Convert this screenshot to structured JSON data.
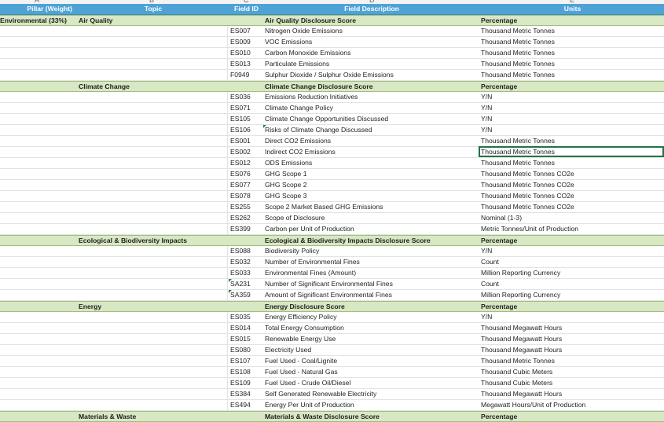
{
  "column_letters": [
    "A",
    "B",
    "C",
    "D",
    "E"
  ],
  "header": {
    "pillar": "Pillar (Weight)",
    "topic": "Topic",
    "field_id": "Field ID",
    "field_description": "Field Description",
    "units": "Units"
  },
  "rows": [
    {
      "type": "topic",
      "pillar": "Environmental (33%)",
      "topic": "Air Quality",
      "id": "",
      "desc": "Air Quality Disclosure Score",
      "unit": "Percentage"
    },
    {
      "type": "data",
      "id": "ES007",
      "desc": "Nitrogen Oxide Emissions",
      "unit": "Thousand Metric Tonnes"
    },
    {
      "type": "data",
      "id": "ES009",
      "desc": "VOC Emissions",
      "unit": "Thousand Metric Tonnes"
    },
    {
      "type": "data",
      "id": "ES010",
      "desc": "Carbon Monoxide Emissions",
      "unit": "Thousand Metric Tonnes"
    },
    {
      "type": "data",
      "id": "ES013",
      "desc": "Particulate Emissions",
      "unit": "Thousand Metric Tonnes"
    },
    {
      "type": "data",
      "id": "F0949",
      "desc": "Sulphur Dioxide / Sulphur Oxide Emissions",
      "unit": "Thousand Metric Tonnes"
    },
    {
      "type": "topic",
      "pillar": "",
      "topic": "Climate Change",
      "id": "",
      "desc": "Climate Change Disclosure Score",
      "unit": "Percentage"
    },
    {
      "type": "data",
      "id": "ES036",
      "desc": "Emissions Reduction Initiatives",
      "unit": "Y/N"
    },
    {
      "type": "data",
      "id": "ES071",
      "desc": "Climate Change Policy",
      "unit": "Y/N"
    },
    {
      "type": "data",
      "id": "ES105",
      "desc": "Climate Change Opportunities Discussed",
      "unit": "Y/N"
    },
    {
      "type": "data",
      "id": "ES106",
      "desc": "Risks of Climate Change Discussed",
      "unit": "Y/N",
      "mark": "d"
    },
    {
      "type": "data",
      "id": "ES001",
      "desc": "Direct CO2 Emissions",
      "unit": "Thousand Metric Tonnes"
    },
    {
      "type": "data",
      "id": "ES002",
      "desc": "Indirect CO2 Emissions",
      "unit": "Thousand Metric Tonnes"
    },
    {
      "type": "data",
      "id": "ES012",
      "desc": "ODS Emissions",
      "unit": "Thousand Metric Tonnes"
    },
    {
      "type": "data",
      "id": "ES076",
      "desc": "GHG Scope 1",
      "unit": "Thousand Metric Tonnes CO2e"
    },
    {
      "type": "data",
      "id": "ES077",
      "desc": "GHG Scope 2",
      "unit": "Thousand Metric Tonnes CO2e"
    },
    {
      "type": "data",
      "id": "ES078",
      "desc": "GHG Scope 3",
      "unit": "Thousand Metric Tonnes CO2e"
    },
    {
      "type": "data",
      "id": "ES255",
      "desc": "Scope 2 Market Based GHG Emissions",
      "unit": "Thousand Metric Tonnes CO2e"
    },
    {
      "type": "data",
      "id": "ES262",
      "desc": "Scope of Disclosure",
      "unit": "Nominal (1-3)"
    },
    {
      "type": "data",
      "id": "ES399",
      "desc": "Carbon per Unit of Production",
      "unit": "Metric Tonnes/Unit of Production"
    },
    {
      "type": "topic",
      "pillar": "",
      "topic": "Ecological & Biodiversity Impacts",
      "id": "",
      "desc": "Ecological & Biodiversity Impacts Disclosure Score",
      "unit": "Percentage"
    },
    {
      "type": "data",
      "id": "ES088",
      "desc": "Biodiversity Policy",
      "unit": "Y/N"
    },
    {
      "type": "data",
      "id": "ES032",
      "desc": "Number of Environmental Fines",
      "unit": "Count"
    },
    {
      "type": "data",
      "id": "ES033",
      "desc": "Environmental Fines (Amount)",
      "unit": "Million Reporting Currency"
    },
    {
      "type": "data",
      "id": "SA231",
      "desc": "Number of Significant Environmental Fines",
      "unit": "Count",
      "mark": "c"
    },
    {
      "type": "data",
      "id": "SA359",
      "desc": "Amount of Significant Environmental Fines",
      "unit": "Million Reporting Currency",
      "mark": "c"
    },
    {
      "type": "topic",
      "pillar": "",
      "topic": "Energy",
      "id": "",
      "desc": "Energy Disclosure Score",
      "unit": "Percentage"
    },
    {
      "type": "data",
      "id": "ES035",
      "desc": "Energy Efficiency Policy",
      "unit": "Y/N"
    },
    {
      "type": "data",
      "id": "ES014",
      "desc": "Total Energy Consumption",
      "unit": "Thousand Megawatt Hours"
    },
    {
      "type": "data",
      "id": "ES015",
      "desc": "Renewable Energy Use",
      "unit": "Thousand Megawatt Hours"
    },
    {
      "type": "data",
      "id": "ES080",
      "desc": "Electricity Used",
      "unit": "Thousand Megawatt Hours"
    },
    {
      "type": "data",
      "id": "ES107",
      "desc": "Fuel Used - Coal/Lignite",
      "unit": "Thousand Metric Tonnes"
    },
    {
      "type": "data",
      "id": "ES108",
      "desc": "Fuel Used - Natural Gas",
      "unit": "Thousand Cubic Meters"
    },
    {
      "type": "data",
      "id": "ES109",
      "desc": "Fuel Used - Crude Oil/Diesel",
      "unit": "Thousand Cubic Meters"
    },
    {
      "type": "data",
      "id": "ES384",
      "desc": "Self Generated Renewable Electricity",
      "unit": "Thousand Megawatt Hours"
    },
    {
      "type": "data",
      "id": "ES494",
      "desc": "Energy Per Unit of Production",
      "unit": "Megawatt Hours/Unit of Production"
    },
    {
      "type": "topic",
      "pillar": "",
      "topic": "Materials & Waste",
      "id": "",
      "desc": "Materials & Waste Disclosure Score",
      "unit": "Percentage"
    }
  ],
  "selected_cell_row": 12
}
